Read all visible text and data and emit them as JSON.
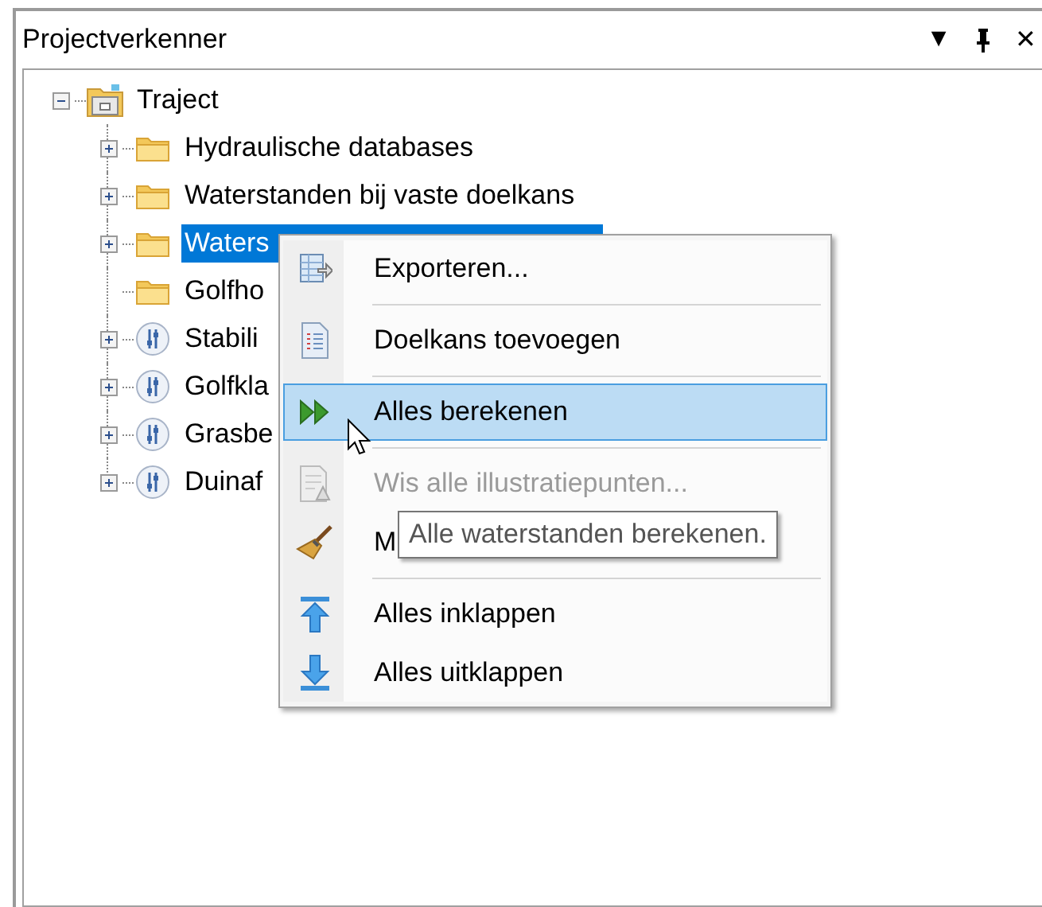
{
  "panel": {
    "title": "Projectverkenner",
    "buttons": [
      {
        "kind": "dropdown",
        "glyph": "▼"
      },
      {
        "kind": "pin"
      },
      {
        "kind": "close",
        "glyph": "✕"
      }
    ]
  },
  "tree": {
    "label": "Traject",
    "kind": "project",
    "expanded": true,
    "selected": false,
    "children": [
      {
        "label": "Hydraulische databases",
        "kind": "folder",
        "expanded": false,
        "selected": false
      },
      {
        "label": "Waterstanden bij vaste doelkans",
        "kind": "folder",
        "expanded": false,
        "selected": false
      },
      {
        "label": "Waters",
        "kind": "folder",
        "expanded": false,
        "selected": true
      },
      {
        "label": "Golfho",
        "kind": "folder",
        "selected": false
      },
      {
        "label": "Stabili",
        "kind": "mechanism",
        "expanded": false,
        "selected": false
      },
      {
        "label": "Golfkla",
        "kind": "mechanism",
        "expanded": false,
        "selected": false
      },
      {
        "label": "Grasbe",
        "kind": "mechanism",
        "expanded": false,
        "selected": false
      },
      {
        "label": "Duinaf",
        "kind": "mechanism",
        "expanded": false,
        "selected": false
      }
    ]
  },
  "context_menu": [
    {
      "kind": "export",
      "label": "Exporteren...",
      "selected": false,
      "disabled": false
    },
    {
      "kind": "separator"
    },
    {
      "kind": "document",
      "label": "Doelkans toevoegen",
      "selected": false,
      "disabled": false
    },
    {
      "kind": "separator"
    },
    {
      "kind": "run",
      "label": "Alles berekenen",
      "selected": true,
      "disabled": false
    },
    {
      "kind": "separator"
    },
    {
      "kind": "clear",
      "label": "Wis alle illustratiepunten...",
      "selected": false,
      "disabled": true
    },
    {
      "kind": "broom",
      "label": "M",
      "selected": false,
      "disabled": false
    },
    {
      "kind": "separator"
    },
    {
      "kind": "collapse",
      "label": "Alles inklappen",
      "selected": false,
      "disabled": false
    },
    {
      "kind": "expand",
      "label": "Alles uitklappen",
      "selected": false,
      "disabled": false
    }
  ],
  "tooltip": "Alle waterstanden berekenen."
}
